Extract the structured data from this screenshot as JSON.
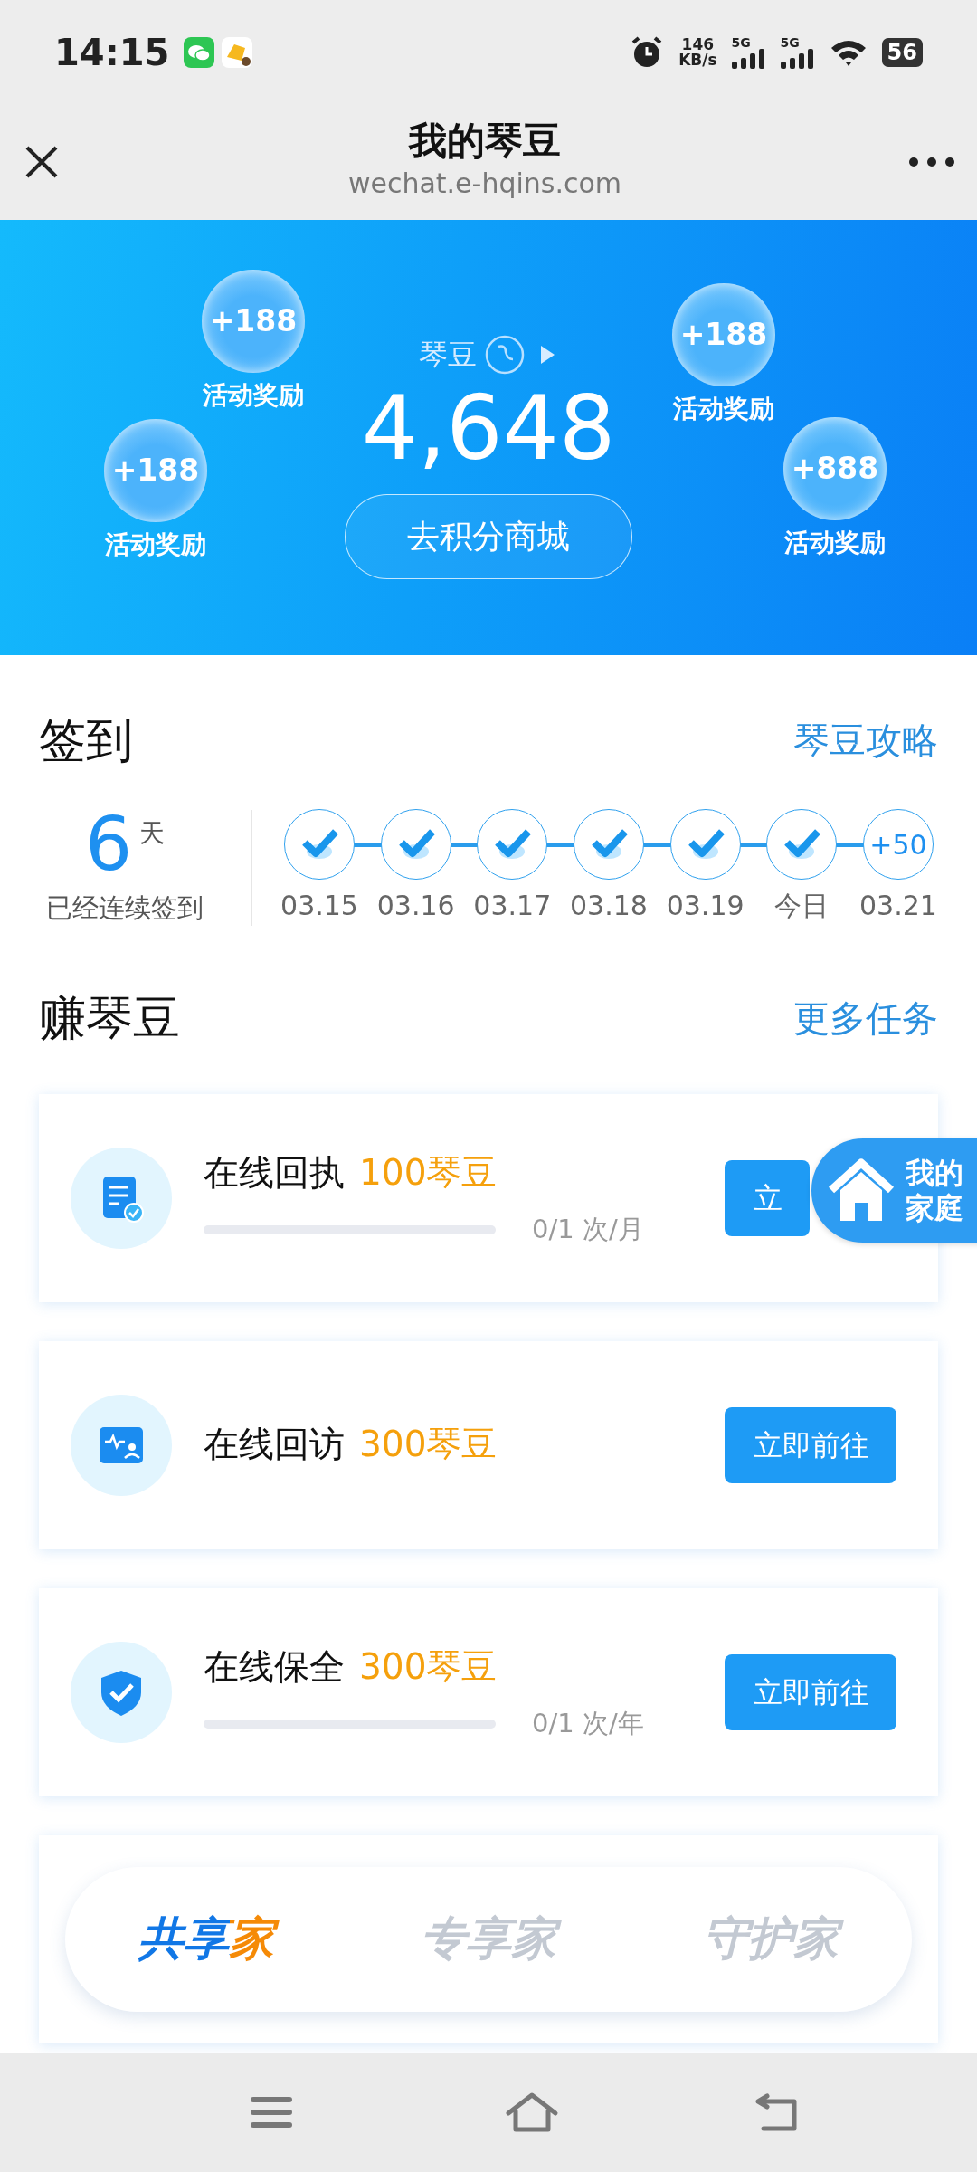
{
  "status_bar": {
    "time": "14:15",
    "network_speed": "146",
    "speed_unit": "KB/s",
    "signals": [
      "5G",
      "5G"
    ],
    "battery": "56"
  },
  "header": {
    "title": "我的琴豆",
    "url": "wechat.e-hqins.com"
  },
  "banner": {
    "label": "琴豆",
    "balance": "4,648",
    "button": "去积分商城",
    "bubbles": [
      {
        "amount": "+188",
        "label": "活动奖励"
      },
      {
        "amount": "+188",
        "label": "活动奖励"
      },
      {
        "amount": "+188",
        "label": "活动奖励"
      },
      {
        "amount": "+888",
        "label": "活动奖励"
      }
    ]
  },
  "sign_in": {
    "title": "签到",
    "link": "琴豆攻略",
    "streak": "6",
    "streak_unit": "天",
    "streak_label": "已经连续签到",
    "days": [
      {
        "date": "03.15",
        "checked": true
      },
      {
        "date": "03.16",
        "checked": true
      },
      {
        "date": "03.17",
        "checked": true
      },
      {
        "date": "03.18",
        "checked": true
      },
      {
        "date": "03.19",
        "checked": true
      },
      {
        "date": "今日",
        "checked": true
      },
      {
        "date": "03.21",
        "checked": false,
        "reward": "+50"
      }
    ]
  },
  "earn": {
    "title": "赚琴豆",
    "link": "更多任务",
    "tasks": [
      {
        "kind": "receipt",
        "name": "在线回执",
        "reward": "100琴豆",
        "level": 0,
        "progress": "0/1 次/月",
        "button": "立"
      },
      {
        "kind": "visit",
        "name": "在线回访",
        "reward": "300琴豆",
        "button": "立即前往"
      },
      {
        "kind": "shield",
        "name": "在线保全",
        "reward": "300琴豆",
        "level": 0,
        "progress": "0/1 次/年",
        "button": "立即前往"
      }
    ]
  },
  "floating_badge": {
    "label": "我的家庭"
  },
  "tiers": [
    {
      "label": "共享家",
      "selected": true
    },
    {
      "label": "专享家",
      "selected": false
    },
    {
      "label": "守护家",
      "selected": false
    }
  ]
}
